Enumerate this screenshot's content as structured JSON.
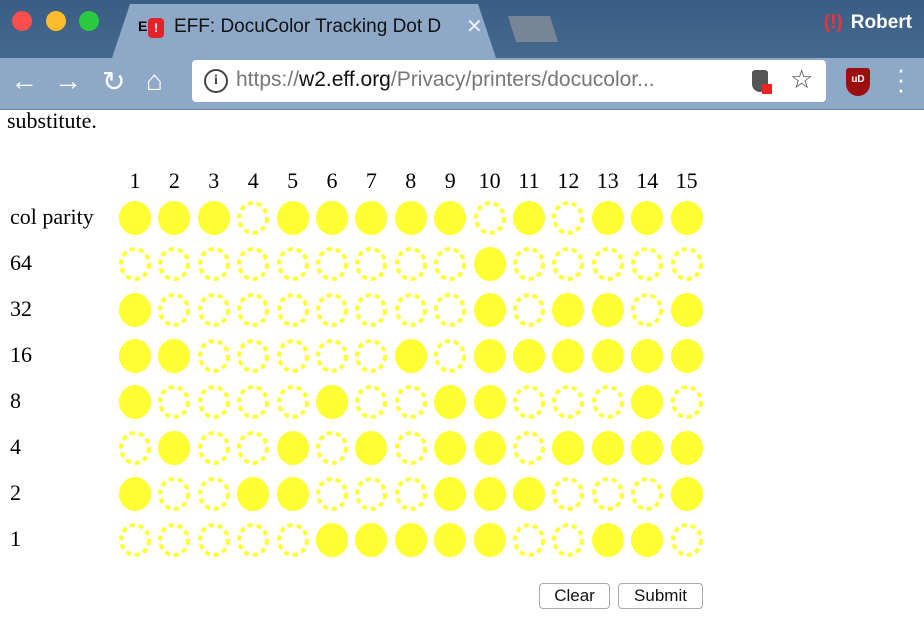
{
  "browser": {
    "tab_title": "EFF: DocuColor Tracking Dot D",
    "tab_favicon_text": "E",
    "profile_name": "Robert",
    "url_scheme": "https://",
    "url_host": "w2.eff.org",
    "url_path": "/Privacy/printers/docucolor...",
    "extension_label": "uD",
    "icons": [
      "back-arrow-icon",
      "forward-arrow-icon",
      "reload-icon",
      "home-icon",
      "info-icon",
      "shield-blocker-icon",
      "star-icon",
      "ublock-icon",
      "menu-dots-icon"
    ]
  },
  "page": {
    "cut_text": "substitute.",
    "column_numbers": [
      "1",
      "2",
      "3",
      "4",
      "5",
      "6",
      "7",
      "8",
      "9",
      "10",
      "11",
      "12",
      "13",
      "14",
      "15"
    ],
    "rows": [
      {
        "label": "col parity",
        "bits": "111011111010111"
      },
      {
        "label": "64",
        "bits": "000000000100000"
      },
      {
        "label": "32",
        "bits": "100000000101101"
      },
      {
        "label": "16",
        "bits": "110000010111111"
      },
      {
        "label": "8",
        "bits": "100001001100010"
      },
      {
        "label": "4",
        "bits": "010010101101111"
      },
      {
        "label": "2",
        "bits": "100110001110001"
      },
      {
        "label": "1",
        "bits": "000001111100110"
      }
    ],
    "dot_color": "#ffff33",
    "clear_label": "Clear",
    "submit_label": "Submit"
  }
}
